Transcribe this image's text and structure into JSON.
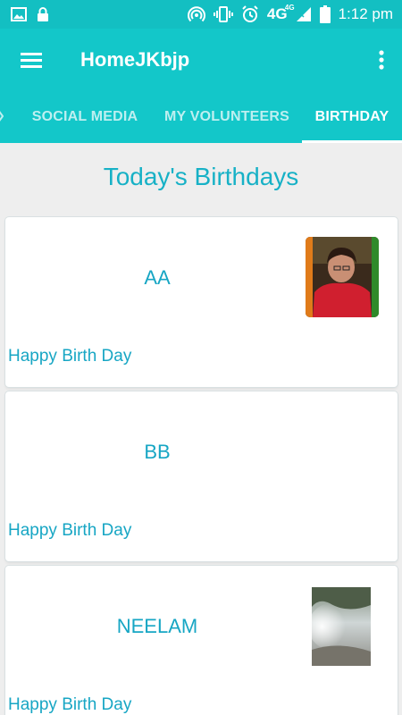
{
  "status_bar": {
    "time": "1:12 pm",
    "network": "4G",
    "network_small": "4G",
    "icons": [
      "gallery-icon",
      "lock-icon",
      "hotspot-icon",
      "vibrate-icon",
      "alarm-icon",
      "signal-icon",
      "battery-icon"
    ]
  },
  "toolbar": {
    "title": "HomeJKbjp",
    "icons": [
      "menu-icon",
      "overflow-menu-icon"
    ]
  },
  "tabs": [
    {
      "label": "SOCIAL MEDIA",
      "active": false
    },
    {
      "label": "MY VOLUNTEERS",
      "active": false
    },
    {
      "label": "BIRTHDAY",
      "active": true
    }
  ],
  "section": {
    "title": "Today's Birthdays"
  },
  "birthdays": [
    {
      "name": "AA",
      "wish": "Happy Birth Day",
      "has_photo": true
    },
    {
      "name": "BB",
      "wish": "Happy Birth Day",
      "has_photo": false
    },
    {
      "name": "NEELAM",
      "wish": "Happy Birth Day",
      "has_photo": true
    }
  ],
  "colors": {
    "primary": "#13c7c9",
    "accent_text": "#17a6c4",
    "background": "#eeeeee"
  }
}
